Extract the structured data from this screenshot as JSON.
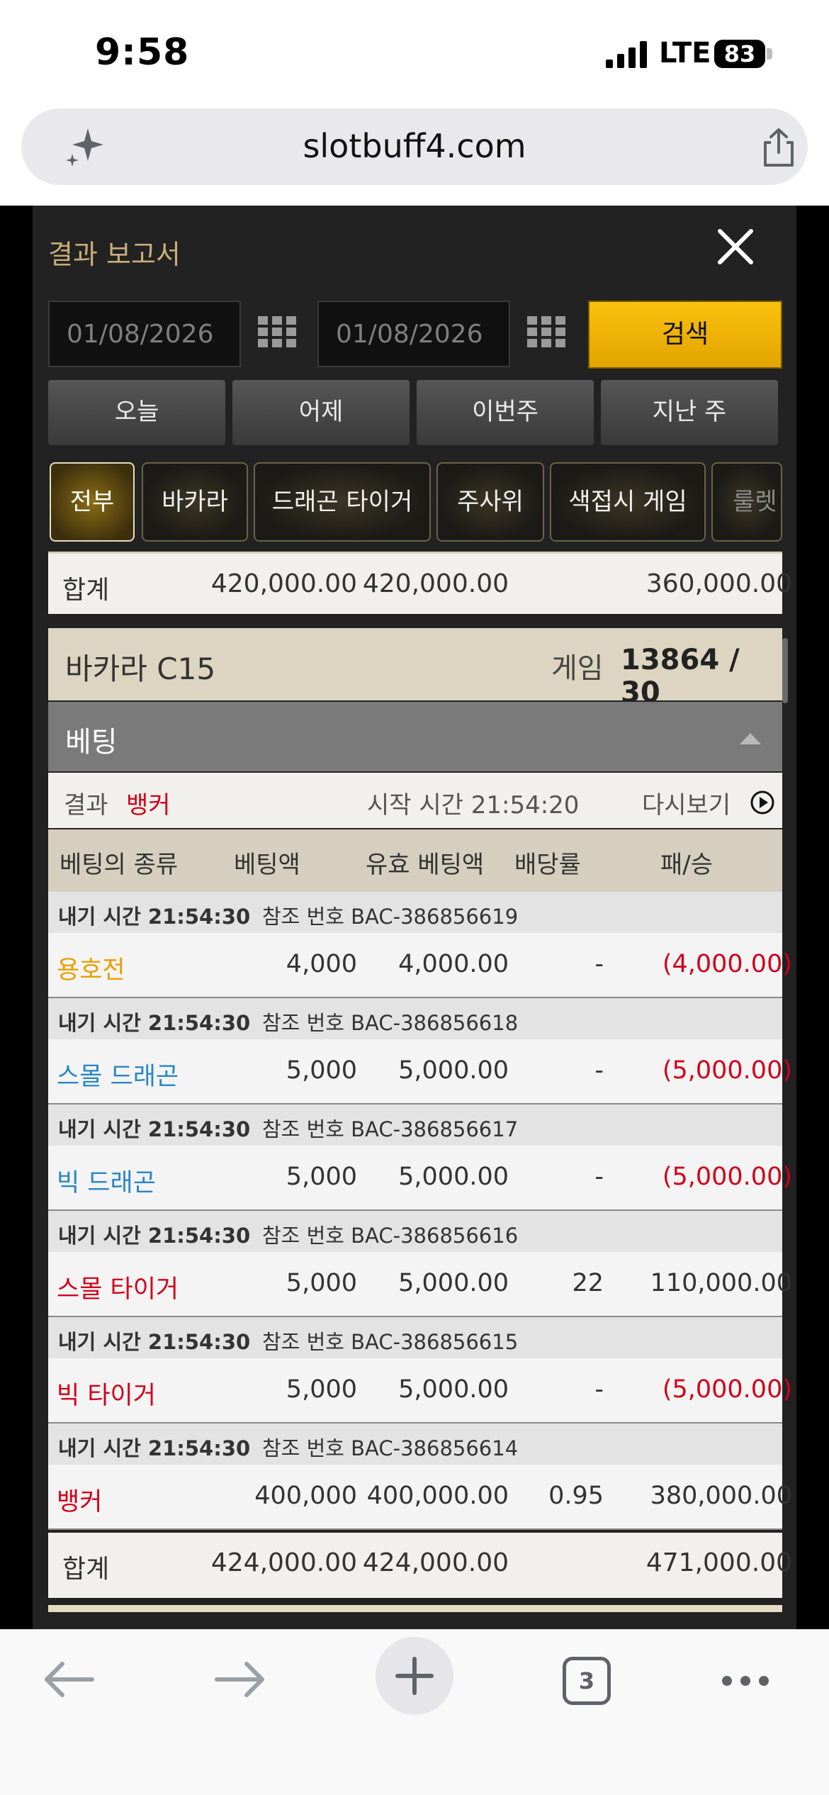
{
  "status": {
    "time": "9:58",
    "network": "LTE",
    "battery": "83"
  },
  "browser": {
    "url": "slotbuff4.com",
    "tabs_count": "3"
  },
  "panel": {
    "title": "결과 보고서",
    "date_from": "01/08/2026",
    "date_to": "01/08/2026",
    "search_label": "검색",
    "periods": [
      "오늘",
      "어제",
      "이번주",
      "지난 주"
    ],
    "categories": [
      "전부",
      "바카라",
      "드래곤 타이거",
      "주사위",
      "색접시 게임",
      "룰렛"
    ]
  },
  "prev_total": {
    "label": "합계",
    "bet": "420,000.00",
    "valid": "420,000.00",
    "winloss": "360,000.00"
  },
  "game": {
    "name": "바카라 C15",
    "game_label": "게임",
    "game_number": "13864 / 30"
  },
  "betting": {
    "label": "베팅",
    "result_label": "결과",
    "result_value": "뱅커",
    "start_time": "시작 시간 21:54:20",
    "replay": "다시보기",
    "columns": [
      "베팅의 종류",
      "베팅액",
      "유효 베팅액",
      "배당률",
      "패/승"
    ],
    "rows": [
      {
        "time": "내기 시간 21:54:30",
        "ref": "참조 번호 BAC-386856619",
        "type": "용호전",
        "type_color": "#e8a000",
        "bet": "4,000",
        "valid": "4,000.00",
        "odds": "-",
        "winloss": "(4,000.00)",
        "negative": true
      },
      {
        "time": "내기 시간 21:54:30",
        "ref": "참조 번호 BAC-386856618",
        "type": "스몰 드래곤",
        "type_color": "#2a86c5",
        "bet": "5,000",
        "valid": "5,000.00",
        "odds": "-",
        "winloss": "(5,000.00)",
        "negative": true
      },
      {
        "time": "내기 시간 21:54:30",
        "ref": "참조 번호 BAC-386856617",
        "type": "빅 드래곤",
        "type_color": "#2a86c5",
        "bet": "5,000",
        "valid": "5,000.00",
        "odds": "-",
        "winloss": "(5,000.00)",
        "negative": true
      },
      {
        "time": "내기 시간 21:54:30",
        "ref": "참조 번호 BAC-386856616",
        "type": "스몰 타이거",
        "type_color": "#d0021b",
        "bet": "5,000",
        "valid": "5,000.00",
        "odds": "22",
        "winloss": "110,000.00",
        "negative": false
      },
      {
        "time": "내기 시간 21:54:30",
        "ref": "참조 번호 BAC-386856615",
        "type": "빅 타이거",
        "type_color": "#d0021b",
        "bet": "5,000",
        "valid": "5,000.00",
        "odds": "-",
        "winloss": "(5,000.00)",
        "negative": true
      },
      {
        "time": "내기 시간 21:54:30",
        "ref": "참조 번호 BAC-386856614",
        "type": "뱅커",
        "type_color": "#d0021b",
        "bet": "400,000",
        "valid": "400,000.00",
        "odds": "0.95",
        "winloss": "380,000.00",
        "negative": false
      }
    ],
    "total": {
      "label": "합계",
      "bet": "424,000.00",
      "valid": "424,000.00",
      "winloss": "471,000.00"
    }
  },
  "colors": {
    "accent_gold": "#f9c20c",
    "negative_red": "#d0021b",
    "panel_bg": "#222222"
  }
}
